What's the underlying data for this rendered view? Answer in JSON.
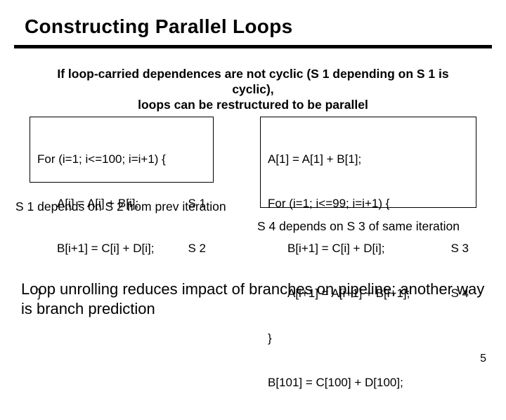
{
  "title": "Constructing Parallel Loops",
  "intro_line1": "If loop-carried dependences are not cyclic (S 1 depending on S 1 is cyclic),",
  "intro_line2": "loops can be restructured to be parallel",
  "left_box": {
    "l1": "For (i=1; i<=100; i=i+1) {",
    "l2": "A[i] = A[i] + B[i];",
    "l2_tag": "S 1",
    "l3": "B[i+1] = C[i] + D[i];",
    "l3_tag": "S 2",
    "l4": "}"
  },
  "left_caption": "S 1 depends on S 2 from prev iteration",
  "right_box": {
    "l1": "A[1] = A[1] + B[1];",
    "l2": "For (i=1; i<=99; i=i+1) {",
    "l3": "B[i+1] = C[i] + D[i];",
    "l3_tag": "S 3",
    "l4": "A[i+1] = A[i+1] + B[i+1];",
    "l4_tag": "S 4",
    "l5": "}",
    "l6": "B[101] = C[100] + D[100];"
  },
  "right_caption": "S 4 depends on S 3 of same iteration",
  "bottom": "Loop unrolling reduces impact of branches on pipeline; another way is branch prediction",
  "page_number": "5"
}
